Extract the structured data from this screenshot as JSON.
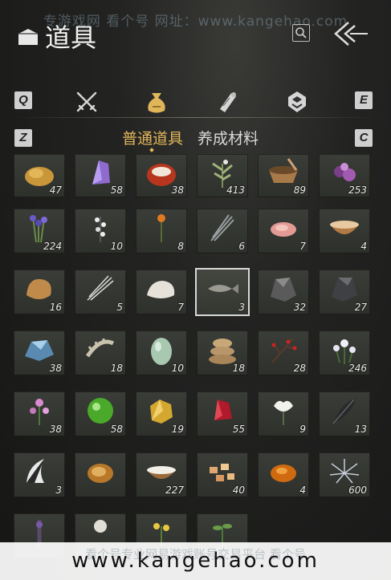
{
  "watermark_top": "专游戏网 看个号   网址：www.kangehao.com",
  "header": {
    "title": "道具"
  },
  "category_tabs": {
    "left_key": "Q",
    "right_key": "E",
    "icons": [
      "crossed-swords-icon",
      "money-bag-icon",
      "scroll-icon",
      "badge-icon"
    ],
    "active_index": 1
  },
  "sub_tabs": {
    "left_key": "Z",
    "right_key": "C",
    "items": [
      {
        "label": "普通道具",
        "active": true
      },
      {
        "label": "养成材料",
        "active": false
      }
    ]
  },
  "colors": {
    "accent": "#e0b65a",
    "cell_bg": "#353832",
    "selected_border": "#d8d8d8"
  },
  "inventory": {
    "items": [
      {
        "icon": "gold-ore-icon",
        "count": "47"
      },
      {
        "icon": "purple-crystal-icon",
        "count": "58"
      },
      {
        "icon": "red-agate-icon",
        "count": "38"
      },
      {
        "icon": "herb-sprig-icon",
        "count": "413"
      },
      {
        "icon": "mortar-bowl-icon",
        "count": "89"
      },
      {
        "icon": "purple-flower-icon",
        "count": "253"
      },
      {
        "icon": "lavender-herb-icon",
        "count": "224"
      },
      {
        "icon": "white-blossom-icon",
        "count": "10"
      },
      {
        "icon": "orange-flower-icon",
        "count": "8"
      },
      {
        "icon": "grass-bundle-icon",
        "count": "6"
      },
      {
        "icon": "raw-meat-icon",
        "count": "7"
      },
      {
        "icon": "soup-bowl-icon",
        "count": "4"
      },
      {
        "icon": "fur-pelt-icon",
        "count": "16"
      },
      {
        "icon": "quills-icon",
        "count": "5"
      },
      {
        "icon": "white-fur-icon",
        "count": "7"
      },
      {
        "icon": "fish-icon",
        "count": "3"
      },
      {
        "icon": "iron-ore-icon",
        "count": "32"
      },
      {
        "icon": "dark-ore-icon",
        "count": "27"
      },
      {
        "icon": "blue-ore-icon",
        "count": "38"
      },
      {
        "icon": "bone-icon",
        "count": "18"
      },
      {
        "icon": "green-egg-icon",
        "count": "10"
      },
      {
        "icon": "sacks-icon",
        "count": "18"
      },
      {
        "icon": "red-berry-branch-icon",
        "count": "28"
      },
      {
        "icon": "white-flower-cluster-icon",
        "count": "246"
      },
      {
        "icon": "pink-flower-icon",
        "count": "38"
      },
      {
        "icon": "green-orb-icon",
        "count": "58"
      },
      {
        "icon": "gold-nugget-icon",
        "count": "19"
      },
      {
        "icon": "red-crystal-icon",
        "count": "55"
      },
      {
        "icon": "white-lily-icon",
        "count": "9"
      },
      {
        "icon": "black-feather-icon",
        "count": "13"
      },
      {
        "icon": "black-white-tail-icon",
        "count": "3"
      },
      {
        "icon": "wood-log-icon",
        "count": ""
      },
      {
        "icon": "rice-bowl-icon",
        "count": "227"
      },
      {
        "icon": "bread-chunks-icon",
        "count": "40"
      },
      {
        "icon": "orange-stone-icon",
        "count": "4"
      },
      {
        "icon": "silver-spider-flower-icon",
        "count": "600"
      },
      {
        "icon": "purple-spike-icon",
        "count": ""
      },
      {
        "icon": "white-bulb-icon",
        "count": ""
      },
      {
        "icon": "yellow-flower-icon",
        "count": ""
      },
      {
        "icon": "green-sprout-icon",
        "count": ""
      }
    ],
    "selected_index": 15
  },
  "watermark_bottom": {
    "cn": "看个号专业网易游戏账号交易平台 看个号",
    "url": "www.kangehao.com"
  }
}
